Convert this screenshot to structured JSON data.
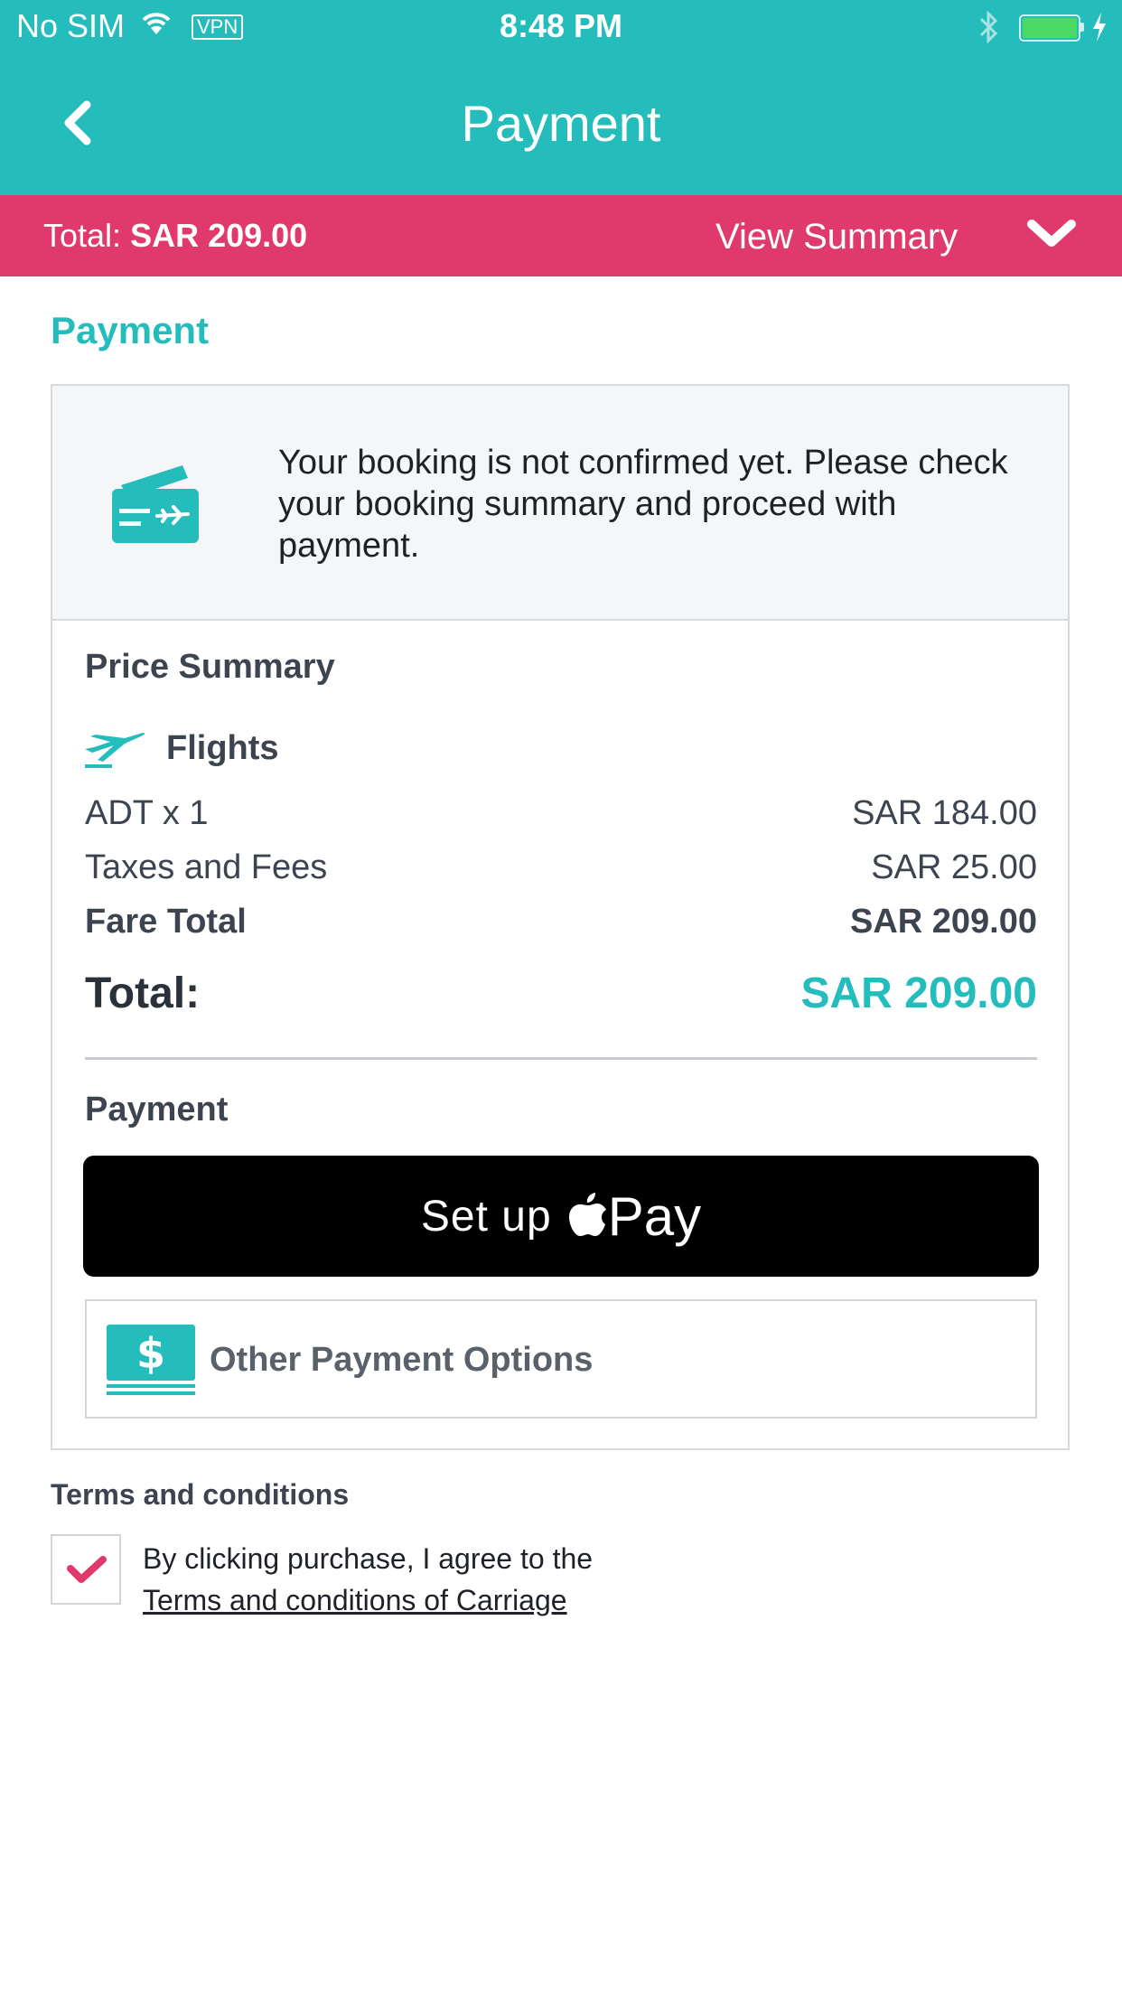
{
  "status_bar": {
    "carrier": "No SIM",
    "vpn": "VPN",
    "time": "8:48 PM"
  },
  "nav": {
    "title": "Payment"
  },
  "summary_bar": {
    "total_label": "Total:",
    "total_value": "SAR 209.00",
    "view_summary": "View Summary"
  },
  "section_title": "Payment",
  "notice": {
    "text": "Your booking is not confirmed yet. Please check your booking summary and proceed with payment."
  },
  "price_summary": {
    "title": "Price Summary",
    "category": "Flights",
    "rows": [
      {
        "label": "ADT x 1",
        "value": "SAR 184.00"
      },
      {
        "label": "Taxes and Fees",
        "value": "SAR 25.00"
      },
      {
        "label": "Fare Total",
        "value": "SAR 209.00"
      }
    ],
    "total_label": "Total:",
    "total_value": "SAR 209.00"
  },
  "payment": {
    "title": "Payment",
    "apple_pay_prefix": "Set up",
    "apple_pay_suffix": "Pay",
    "other_options": "Other Payment Options"
  },
  "terms": {
    "title": "Terms and conditions",
    "text": "By clicking purchase, I agree to the",
    "link": "Terms and conditions of Carriage",
    "checked": true
  },
  "colors": {
    "teal": "#25bcbc",
    "pink": "#e03a6c"
  }
}
